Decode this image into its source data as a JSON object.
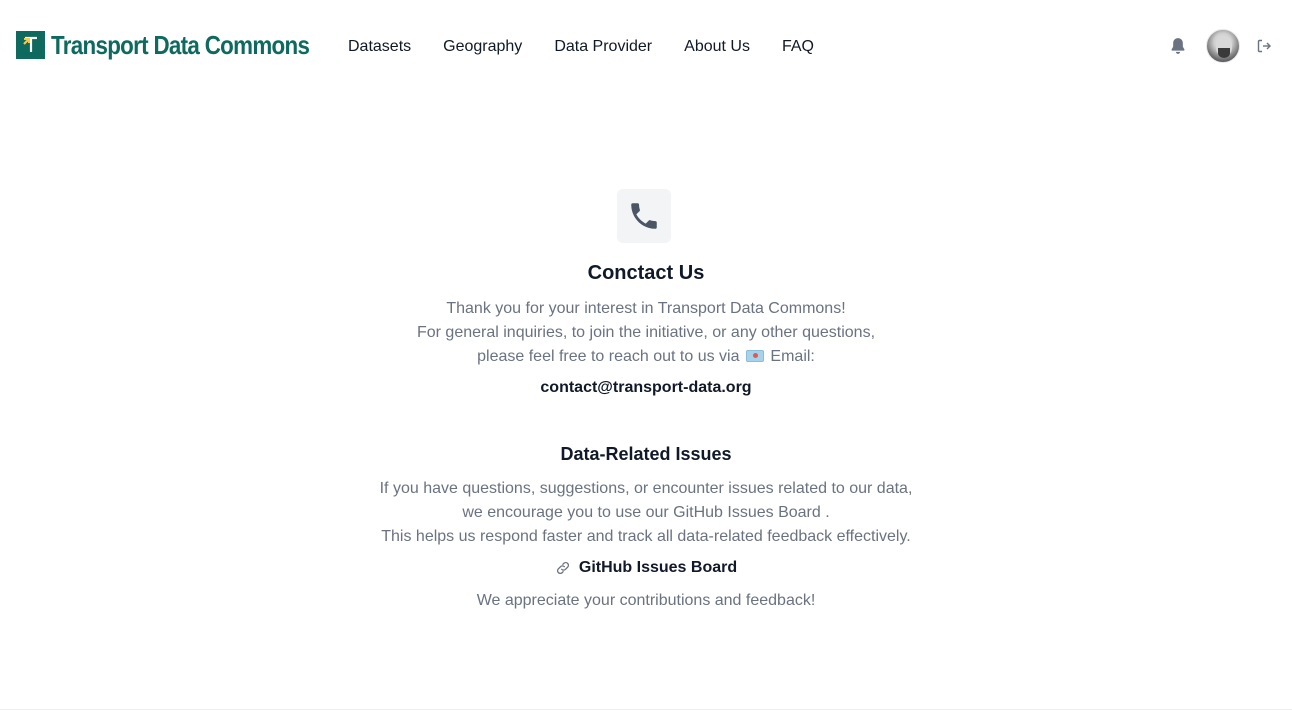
{
  "header": {
    "logo_text": "Transport Data Commons",
    "nav": [
      {
        "label": "Datasets"
      },
      {
        "label": "Geography"
      },
      {
        "label": "Data Provider"
      },
      {
        "label": "About Us"
      },
      {
        "label": "FAQ"
      }
    ],
    "icons": {
      "notifications": "bell-icon",
      "user": "avatar",
      "logout": "logout-icon"
    }
  },
  "main": {
    "title": "Conctact Us",
    "intro_lines": [
      "Thank you for your interest in Transport Data Commons!",
      "For general inquiries, to join the initiative, or any other questions,"
    ],
    "email_line": {
      "before": "please feel free to reach out to us via",
      "after": "Email:"
    },
    "email_address": "contact@transport-data.org",
    "data_issues": {
      "heading": "Data-Related Issues",
      "lines": [
        "If you have questions, suggestions, or encounter issues related to our data,",
        "we encourage you to use our GitHub Issues Board .",
        "This helps us respond faster and track all data-related feedback effectively."
      ],
      "link_label": "GitHub Issues Board",
      "closing": "We appreciate your contributions and feedback!"
    }
  },
  "colors": {
    "brand": "#0e6a5e",
    "text": "#111827",
    "muted": "#6b7280",
    "icon_gray": "#4b5563"
  }
}
